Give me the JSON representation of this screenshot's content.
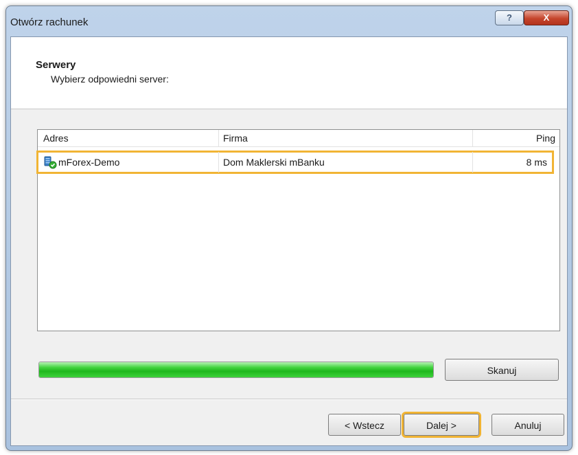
{
  "window": {
    "title": "Otwórz rachunek",
    "help_icon": "question-mark-icon",
    "close_icon": "close-icon",
    "help_label": "?",
    "close_label": "X"
  },
  "header": {
    "title": "Serwery",
    "subtitle": "Wybierz odpowiedni server:"
  },
  "server_list": {
    "columns": [
      "Adres",
      "Firma",
      "Ping"
    ],
    "rows": [
      {
        "adres": "mForex-Demo",
        "firma": "Dom Maklerski mBanku",
        "ping": "8 ms",
        "icon": "server-icon",
        "selected": true
      }
    ]
  },
  "progress": {
    "value": 1.0,
    "color": "#2ecc2b"
  },
  "buttons": {
    "scan": "Skanuj",
    "back": "< Wstecz",
    "next": "Dalej >",
    "cancel": "Anuluj"
  },
  "colors": {
    "highlight": "#f1b434",
    "titlebar": "#b5cbe6",
    "close": "#c5452c"
  }
}
